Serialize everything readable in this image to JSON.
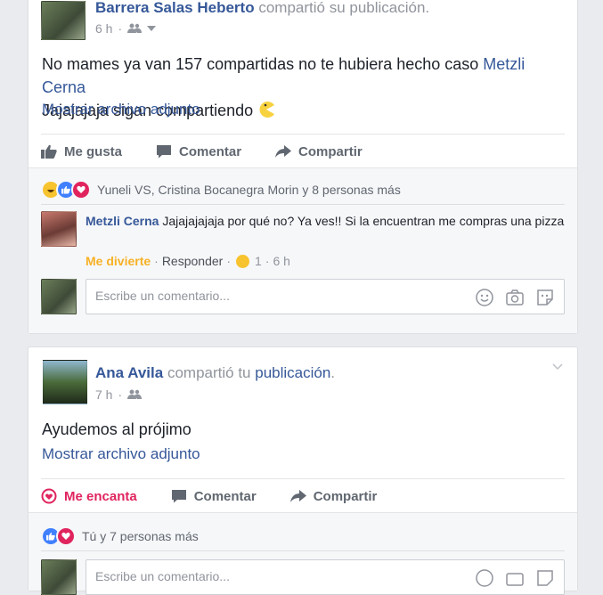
{
  "post1": {
    "author": "Barrera Salas Heberto",
    "action_text": "compartió su publicación.",
    "time": "6 h",
    "text_before": "No mames ya van 157 compartidas no te hubiera hecho caso ",
    "mention": "Metzli Cerna",
    "text_after": "Jajajajaja sigan compartiendo",
    "attachment": "Mostrar archivo adjunto",
    "actions": {
      "like": "Me gusta",
      "comment": "Comentar",
      "share": "Compartir"
    },
    "reactions_text": "Yuneli VS, Cristina Bocanegra Morin y 8 personas más",
    "comment": {
      "name": "Metzli Cerna",
      "text": "Jajajajajaja por qué no? Ya ves!! Si la encuentran me compras una pizza",
      "reaction": "Me divierte",
      "reply": "Responder",
      "sep": "·",
      "count": "1",
      "time": "6 h"
    },
    "input_placeholder": "Escribe un comentario..."
  },
  "post2": {
    "author": "Ana Avila",
    "action_mid": "compartió tu",
    "action_link": "publicación",
    "action_end": ".",
    "time": "7 h",
    "text": "Ayudemos al prójimo",
    "attachment": "Mostrar archivo adjunto",
    "actions": {
      "like": "Me encanta",
      "comment": "Comentar",
      "share": "Compartir"
    },
    "reactions_text": "Tú y 7 personas más",
    "input_placeholder": "Escribe un comentario..."
  },
  "colors": {
    "brand": "#365899",
    "love": "#e0245e",
    "haha": "#f7b125",
    "like": "#4080ff"
  }
}
